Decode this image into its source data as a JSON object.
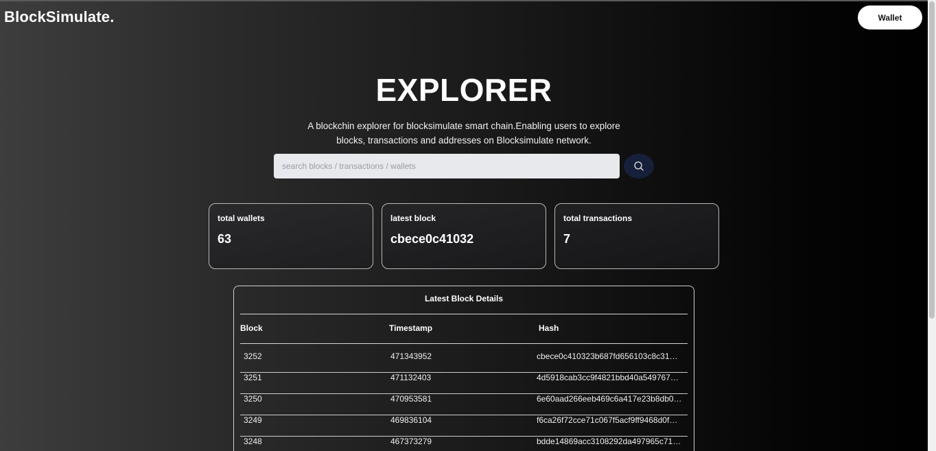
{
  "header": {
    "logo": "BlockSimulate.",
    "wallet_label": "Wallet"
  },
  "hero": {
    "title": "EXPLORER",
    "description": "A blockchin explorer for blocksimulate smart chain.Enabling users to explore blocks, transactions and addresses on Blocksimulate network."
  },
  "search": {
    "placeholder": "search blocks / transactions / wallets",
    "value": "",
    "icon": "search-icon"
  },
  "stats": [
    {
      "label": "total wallets",
      "value": "63"
    },
    {
      "label": "latest block",
      "value": "cbece0c41032"
    },
    {
      "label": "total transactions",
      "value": "7"
    }
  ],
  "latest_blocks": {
    "title": "Latest Block Details",
    "columns": [
      "Block",
      "Timestamp",
      "Hash"
    ],
    "rows": [
      {
        "block": "3252",
        "timestamp": "471343952",
        "hash": "cbece0c410323b687fd656103c8c31…"
      },
      {
        "block": "3251",
        "timestamp": "471132403",
        "hash": "4d5918cab3cc9f4821bbd40a549767…"
      },
      {
        "block": "3250",
        "timestamp": "470953581",
        "hash": "6e60aad266eeb469c6a417e23b8db0…"
      },
      {
        "block": "3249",
        "timestamp": "469836104",
        "hash": "f6ca26f72cce71c067f5acf9ff9468d0f…"
      },
      {
        "block": "3248",
        "timestamp": "467373279",
        "hash": "bdde14869acc3108292da497965c71…"
      }
    ]
  },
  "colors": {
    "search_button": "#17203a",
    "search_input_bg": "#e8e9ed",
    "card_border": "#b9b9b9"
  }
}
